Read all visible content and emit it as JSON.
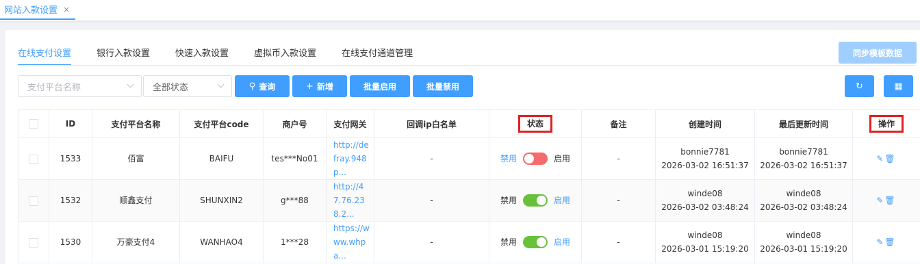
{
  "page_tab": {
    "label": "网站入款设置",
    "close": "×"
  },
  "tabs": [
    "在线支付设置",
    "银行入款设置",
    "快速入款设置",
    "虚拟币入款设置",
    "在线支付通道管理"
  ],
  "sync_button": "同步模板数据",
  "filters": {
    "platform_placeholder": "支付平台名称",
    "status_value": "全部状态"
  },
  "buttons": {
    "query": "查询",
    "add": "新增",
    "batch_enable": "批量启用",
    "batch_disable": "批量禁用"
  },
  "icons": {
    "query": "search-icon",
    "add": "plus-icon",
    "refresh": "refresh-icon",
    "grid": "grid-icon",
    "edit": "edit-icon",
    "delete": "trash-icon"
  },
  "colors": {
    "accent": "#409eff",
    "switch_off": "#f56c6c",
    "switch_on": "#67c23a",
    "highlight": "#e02020"
  },
  "table": {
    "headers": [
      "ID",
      "支付平台名称",
      "支付平台code",
      "商户号",
      "支付网关",
      "回调ip白名单",
      "状态",
      "备注",
      "创建时间",
      "最后更新时间",
      "操作"
    ],
    "disable_label": "禁用",
    "enable_label": "启用",
    "rows": [
      {
        "id": "1533",
        "name": "佰富",
        "code": "BAIFU",
        "merchant": "tes***No01",
        "gateway": "http://defray.948p...",
        "whitelist": "-",
        "enabled": false,
        "remark": "-",
        "creator": "bonnie7781",
        "created": "2026-03-02 16:51:37",
        "updater": "bonnie7781",
        "updated": "2026-03-02 16:51:37"
      },
      {
        "id": "1532",
        "name": "顺鑫支付",
        "code": "SHUNXIN2",
        "merchant": "g***88",
        "gateway": "http://47.76.238.2...",
        "whitelist": "-",
        "enabled": true,
        "remark": "-",
        "creator": "winde08",
        "created": "2026-03-02 03:48:24",
        "updater": "winde08",
        "updated": "2026-03-02 03:48:24"
      },
      {
        "id": "1530",
        "name": "万豪支付4",
        "code": "WANHAO4",
        "merchant": "1***28",
        "gateway": "https://www.whpa...",
        "whitelist": "-",
        "enabled": true,
        "remark": "-",
        "creator": "winde08",
        "created": "2026-03-01 15:19:20",
        "updater": "winde08",
        "updated": "2026-03-01 15:19:20"
      }
    ]
  }
}
